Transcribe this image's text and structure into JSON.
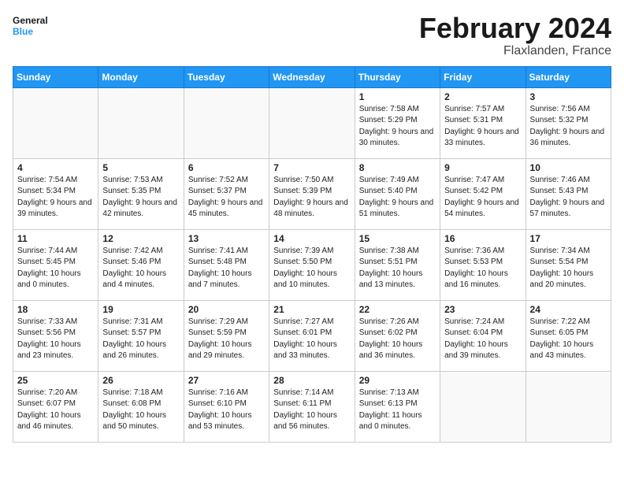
{
  "header": {
    "logo_general": "General",
    "logo_blue": "Blue",
    "month_title": "February 2024",
    "location": "Flaxlanden, France"
  },
  "days_of_week": [
    "Sunday",
    "Monday",
    "Tuesday",
    "Wednesday",
    "Thursday",
    "Friday",
    "Saturday"
  ],
  "weeks": [
    [
      {
        "day": "",
        "info": ""
      },
      {
        "day": "",
        "info": ""
      },
      {
        "day": "",
        "info": ""
      },
      {
        "day": "",
        "info": ""
      },
      {
        "day": "1",
        "info": "Sunrise: 7:58 AM\nSunset: 5:29 PM\nDaylight: 9 hours and 30 minutes."
      },
      {
        "day": "2",
        "info": "Sunrise: 7:57 AM\nSunset: 5:31 PM\nDaylight: 9 hours and 33 minutes."
      },
      {
        "day": "3",
        "info": "Sunrise: 7:56 AM\nSunset: 5:32 PM\nDaylight: 9 hours and 36 minutes."
      }
    ],
    [
      {
        "day": "4",
        "info": "Sunrise: 7:54 AM\nSunset: 5:34 PM\nDaylight: 9 hours and 39 minutes."
      },
      {
        "day": "5",
        "info": "Sunrise: 7:53 AM\nSunset: 5:35 PM\nDaylight: 9 hours and 42 minutes."
      },
      {
        "day": "6",
        "info": "Sunrise: 7:52 AM\nSunset: 5:37 PM\nDaylight: 9 hours and 45 minutes."
      },
      {
        "day": "7",
        "info": "Sunrise: 7:50 AM\nSunset: 5:39 PM\nDaylight: 9 hours and 48 minutes."
      },
      {
        "day": "8",
        "info": "Sunrise: 7:49 AM\nSunset: 5:40 PM\nDaylight: 9 hours and 51 minutes."
      },
      {
        "day": "9",
        "info": "Sunrise: 7:47 AM\nSunset: 5:42 PM\nDaylight: 9 hours and 54 minutes."
      },
      {
        "day": "10",
        "info": "Sunrise: 7:46 AM\nSunset: 5:43 PM\nDaylight: 9 hours and 57 minutes."
      }
    ],
    [
      {
        "day": "11",
        "info": "Sunrise: 7:44 AM\nSunset: 5:45 PM\nDaylight: 10 hours and 0 minutes."
      },
      {
        "day": "12",
        "info": "Sunrise: 7:42 AM\nSunset: 5:46 PM\nDaylight: 10 hours and 4 minutes."
      },
      {
        "day": "13",
        "info": "Sunrise: 7:41 AM\nSunset: 5:48 PM\nDaylight: 10 hours and 7 minutes."
      },
      {
        "day": "14",
        "info": "Sunrise: 7:39 AM\nSunset: 5:50 PM\nDaylight: 10 hours and 10 minutes."
      },
      {
        "day": "15",
        "info": "Sunrise: 7:38 AM\nSunset: 5:51 PM\nDaylight: 10 hours and 13 minutes."
      },
      {
        "day": "16",
        "info": "Sunrise: 7:36 AM\nSunset: 5:53 PM\nDaylight: 10 hours and 16 minutes."
      },
      {
        "day": "17",
        "info": "Sunrise: 7:34 AM\nSunset: 5:54 PM\nDaylight: 10 hours and 20 minutes."
      }
    ],
    [
      {
        "day": "18",
        "info": "Sunrise: 7:33 AM\nSunset: 5:56 PM\nDaylight: 10 hours and 23 minutes."
      },
      {
        "day": "19",
        "info": "Sunrise: 7:31 AM\nSunset: 5:57 PM\nDaylight: 10 hours and 26 minutes."
      },
      {
        "day": "20",
        "info": "Sunrise: 7:29 AM\nSunset: 5:59 PM\nDaylight: 10 hours and 29 minutes."
      },
      {
        "day": "21",
        "info": "Sunrise: 7:27 AM\nSunset: 6:01 PM\nDaylight: 10 hours and 33 minutes."
      },
      {
        "day": "22",
        "info": "Sunrise: 7:26 AM\nSunset: 6:02 PM\nDaylight: 10 hours and 36 minutes."
      },
      {
        "day": "23",
        "info": "Sunrise: 7:24 AM\nSunset: 6:04 PM\nDaylight: 10 hours and 39 minutes."
      },
      {
        "day": "24",
        "info": "Sunrise: 7:22 AM\nSunset: 6:05 PM\nDaylight: 10 hours and 43 minutes."
      }
    ],
    [
      {
        "day": "25",
        "info": "Sunrise: 7:20 AM\nSunset: 6:07 PM\nDaylight: 10 hours and 46 minutes."
      },
      {
        "day": "26",
        "info": "Sunrise: 7:18 AM\nSunset: 6:08 PM\nDaylight: 10 hours and 50 minutes."
      },
      {
        "day": "27",
        "info": "Sunrise: 7:16 AM\nSunset: 6:10 PM\nDaylight: 10 hours and 53 minutes."
      },
      {
        "day": "28",
        "info": "Sunrise: 7:14 AM\nSunset: 6:11 PM\nDaylight: 10 hours and 56 minutes."
      },
      {
        "day": "29",
        "info": "Sunrise: 7:13 AM\nSunset: 6:13 PM\nDaylight: 11 hours and 0 minutes."
      },
      {
        "day": "",
        "info": ""
      },
      {
        "day": "",
        "info": ""
      }
    ]
  ]
}
